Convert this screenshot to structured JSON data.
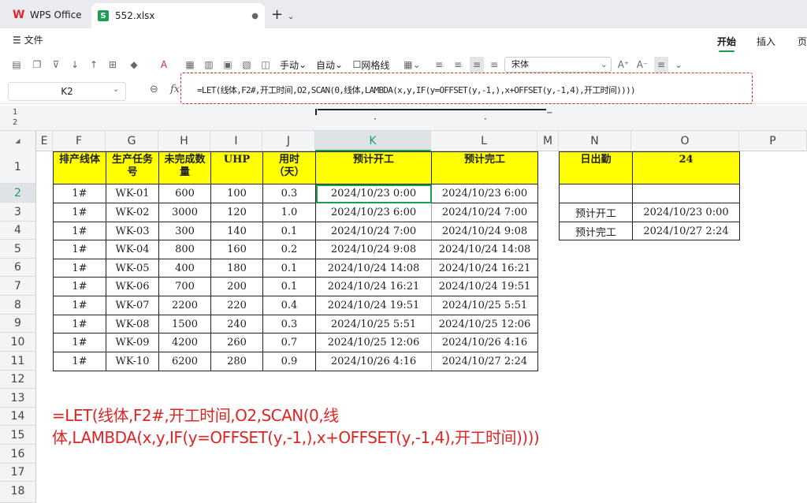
{
  "app": {
    "name": "WPS Office",
    "file_tab": "552.xlsx",
    "menu_file": "文件",
    "ribbon_tabs": [
      "开始",
      "插入",
      "页"
    ]
  },
  "toolbar": {
    "manual": "手动",
    "auto": "自动",
    "gridlines": "网格线",
    "font": "宋体"
  },
  "formula_bar": {
    "cell_ref": "K2",
    "fx": "fx",
    "formula": "=LET(线体,F2#,开工时间,O2,SCAN(0,线体,LAMBDA(x,y,IF(y=OFFSET(y,-1,),x+OFFSET(y,-1,4),开工时间))))"
  },
  "outline_levels": [
    "1",
    "2"
  ],
  "columns": [
    "E",
    "F",
    "G",
    "H",
    "I",
    "J",
    "K",
    "L",
    "M",
    "N",
    "O",
    "P"
  ],
  "rows": [
    "1",
    "2",
    "3",
    "4",
    "5",
    "6",
    "7",
    "8",
    "9",
    "10",
    "11",
    "12",
    "13",
    "14",
    "15",
    "16",
    "17",
    "18"
  ],
  "table": {
    "headers": [
      "排产线体",
      "生产任务号",
      "未完成数量",
      "UHP",
      "用时（天）",
      "预计开工",
      "预计完工"
    ],
    "rows": [
      [
        "1#",
        "WK-01",
        "600",
        "100",
        "0.3",
        "2024/10/23 0:00",
        "2024/10/23 6:00"
      ],
      [
        "1#",
        "WK-02",
        "3000",
        "120",
        "1.0",
        "2024/10/23 6:00",
        "2024/10/24 7:00"
      ],
      [
        "1#",
        "WK-03",
        "300",
        "140",
        "0.1",
        "2024/10/24 7:00",
        "2024/10/24 9:08"
      ],
      [
        "1#",
        "WK-04",
        "800",
        "160",
        "0.2",
        "2024/10/24 9:08",
        "2024/10/24 14:08"
      ],
      [
        "1#",
        "WK-05",
        "400",
        "180",
        "0.1",
        "2024/10/24 14:08",
        "2024/10/24 16:21"
      ],
      [
        "1#",
        "WK-06",
        "700",
        "200",
        "0.1",
        "2024/10/24 16:21",
        "2024/10/24 19:51"
      ],
      [
        "1#",
        "WK-07",
        "2200",
        "220",
        "0.4",
        "2024/10/24 19:51",
        "2024/10/25 5:51"
      ],
      [
        "1#",
        "WK-08",
        "1500",
        "240",
        "0.3",
        "2024/10/25 5:51",
        "2024/10/25 12:06"
      ],
      [
        "1#",
        "WK-09",
        "4200",
        "260",
        "0.7",
        "2024/10/25 12:06",
        "2024/10/26 4:16"
      ],
      [
        "1#",
        "WK-10",
        "6200",
        "280",
        "0.9",
        "2024/10/26 4:16",
        "2024/10/27 2:24"
      ]
    ]
  },
  "side_table": {
    "header": [
      "日出勤",
      "24"
    ],
    "rows": [
      [
        "预计开工",
        "2024/10/23 0:00"
      ],
      [
        "预计完工",
        "2024/10/27 2:24"
      ]
    ]
  },
  "note": {
    "line1": "=LET(线体,F2#,开工时间,O2,SCAN(0,线",
    "line2": "体,LAMBDA(x,y,IF(y=OFFSET(y,-1,),x+OFFSET(y,-1,4),开工时间))))"
  }
}
